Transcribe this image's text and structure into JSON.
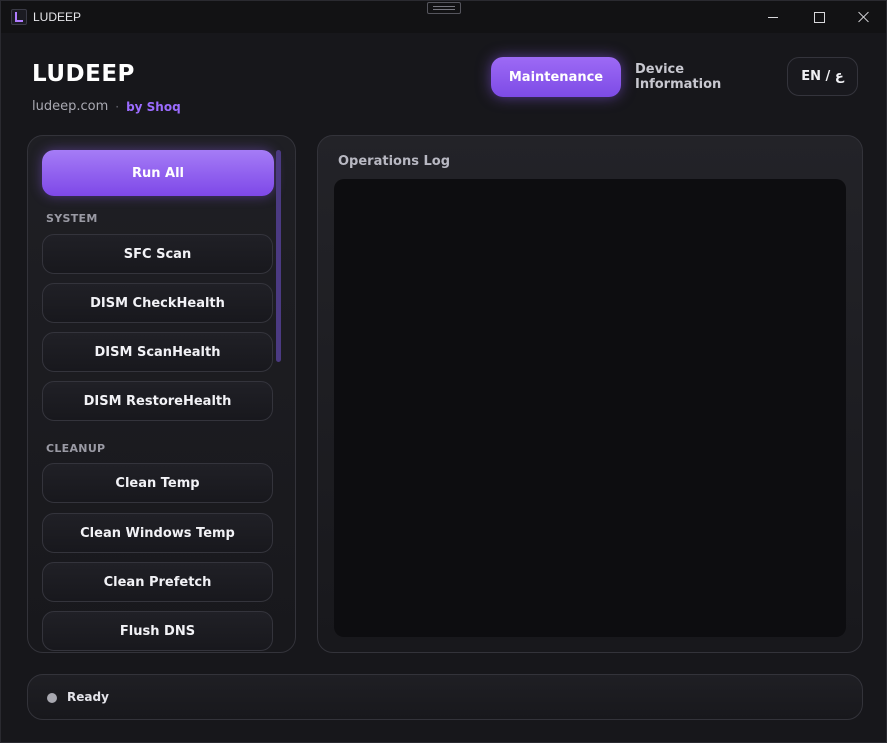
{
  "window": {
    "title": "LUDEEP",
    "controls": [
      "minimize-icon",
      "maximize-icon",
      "close-icon"
    ]
  },
  "header": {
    "title": "LUDEEP",
    "site": "ludeep.com",
    "separator": "·",
    "by": "by Shoq",
    "tabs": [
      {
        "label": "Maintenance",
        "active": true
      },
      {
        "label": "Device Information",
        "active": false
      }
    ],
    "language_toggle": "EN / ع"
  },
  "tasks": {
    "run_all": "Run All",
    "sections": [
      {
        "label": "SYSTEM",
        "items": [
          "SFC Scan",
          "DISM CheckHealth",
          "DISM ScanHealth",
          "DISM RestoreHealth"
        ]
      },
      {
        "label": "CLEANUP",
        "items": [
          "Clean Temp",
          "Clean Windows Temp",
          "Clean Prefetch",
          "Flush DNS"
        ]
      }
    ]
  },
  "log": {
    "title": "Operations Log",
    "content": ""
  },
  "status": {
    "text": "Ready"
  },
  "colors": {
    "accent": "#8b5cf6",
    "background": "#17171b",
    "log_background": "#0d0d10",
    "status_dot": "#a8a8b0"
  }
}
